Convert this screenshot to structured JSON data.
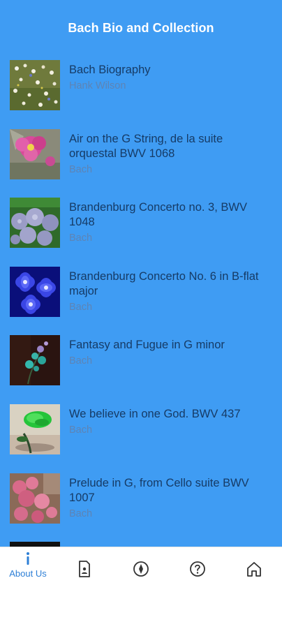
{
  "header": {
    "title": "Bach Bio and Collection"
  },
  "items": [
    {
      "title": "Bach Biography",
      "subtitle": "Hank Wilson",
      "thumb_icon": "wildflowers-photo"
    },
    {
      "title": "Air on the G String, de la suite orquestal BWV 1068",
      "subtitle": "Bach",
      "thumb_icon": "pink-flower-photo"
    },
    {
      "title": "Brandenburg Concerto no. 3, BWV 1048",
      "subtitle": "Bach",
      "thumb_icon": "lilac-flowers-photo"
    },
    {
      "title": "Brandenburg Concerto No. 6 in B-flat major",
      "subtitle": "Bach",
      "thumb_icon": "blue-flowers-photo"
    },
    {
      "title": "Fantasy and Fugue in G minor",
      "subtitle": "Bach",
      "thumb_icon": "teal-flower-dark-photo"
    },
    {
      "title": "We believe in one God. BWV 437",
      "subtitle": "Bach",
      "thumb_icon": "green-rose-photo"
    },
    {
      "title": "Prelude in G, from Cello suite BWV 1007",
      "subtitle": "Bach",
      "thumb_icon": "pink-blossoms-photo"
    }
  ],
  "nav": {
    "about_label": "About Us",
    "icons": [
      "info-icon",
      "contact-card-icon",
      "compass-icon",
      "help-icon",
      "home-icon"
    ]
  },
  "colors": {
    "background": "#3f9cf3",
    "accent": "#2d7fd6",
    "title_text": "#163b66",
    "subtitle_text": "#5d84b5"
  }
}
